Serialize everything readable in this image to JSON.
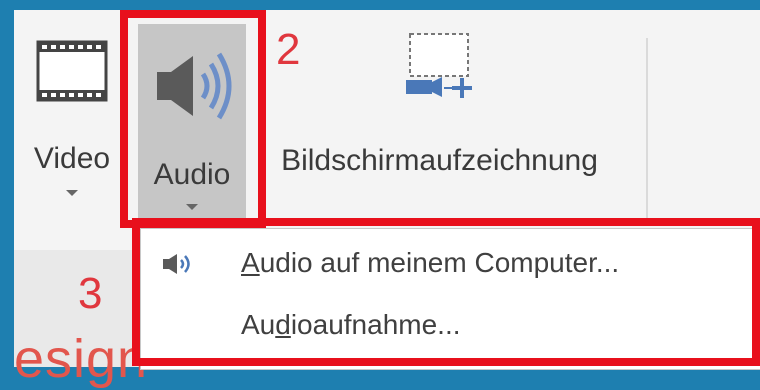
{
  "ribbon": {
    "buttons": [
      {
        "label": "Video",
        "icon": "film-strip-icon"
      },
      {
        "label": "Audio",
        "icon": "speaker-icon"
      },
      {
        "label": "Bildschirmaufzeichnung",
        "icon": "screen-recording-icon"
      }
    ]
  },
  "callouts": {
    "step2": "2",
    "step3": "3"
  },
  "menu": {
    "items": [
      {
        "prefix": "",
        "accel": "A",
        "rest": "udio auf meinem Computer...",
        "icon": "speaker-small-icon"
      },
      {
        "prefix": "Au",
        "accel": "d",
        "rest": "ioaufnahme..."
      }
    ]
  },
  "background_text": "esign",
  "colors": {
    "highlight": "#e8101c",
    "callout": "#e0373e",
    "accent": "#1e7fb0"
  }
}
